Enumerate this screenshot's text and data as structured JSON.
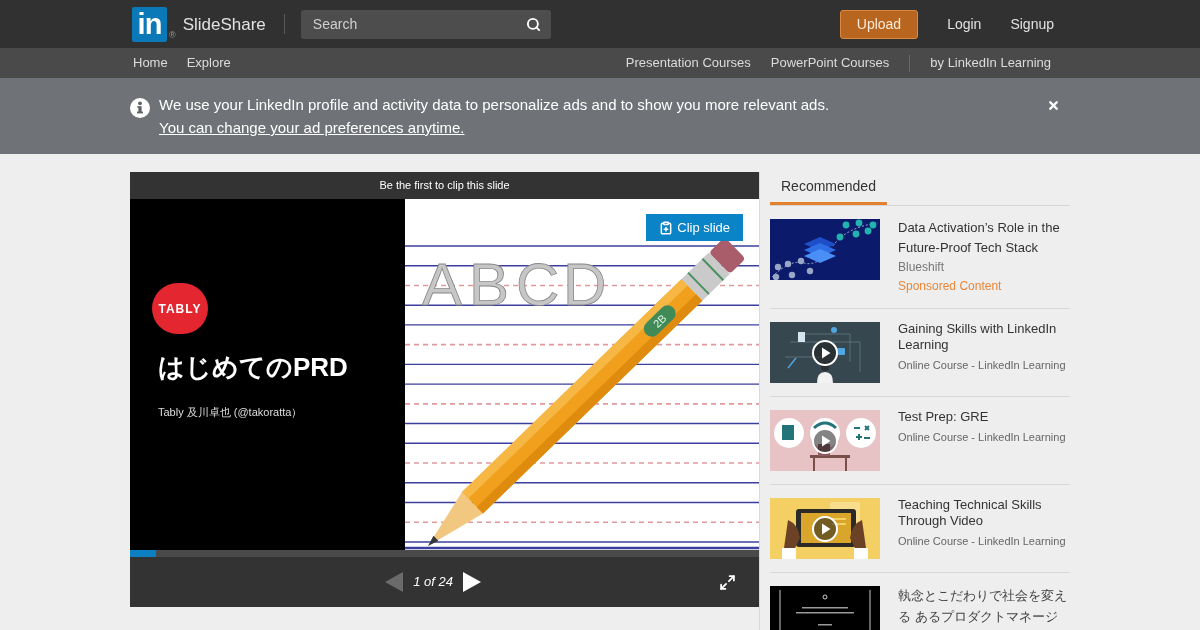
{
  "header": {
    "logo": {
      "mark": "in",
      "registered": "®",
      "name": "SlideShare"
    },
    "search": {
      "placeholder": "Search"
    },
    "buttons": [
      {
        "kind": "primary",
        "label": "Upload"
      },
      {
        "kind": "link",
        "label": "Login"
      },
      {
        "kind": "link",
        "label": "Signup"
      }
    ]
  },
  "sub_nav": {
    "left": [
      "Home",
      "Explore"
    ],
    "right": [
      "Presentation Courses",
      "PowerPoint Courses"
    ],
    "partner": "by LinkedIn Learning"
  },
  "notice": {
    "text": "We use your LinkedIn profile and activity data to personalize ads and to show you more relevant ads.",
    "link": "You can change your ad preferences anytime."
  },
  "player": {
    "clip_bar": "Be the first to clip this slide",
    "slide": {
      "logo": "TABLY",
      "title": "はじめてのPRD",
      "byline": "Tably 及川卓也 (@takoratta）",
      "paper_letters": [
        "A",
        "B",
        "C",
        "D"
      ],
      "pencil_label": "2B"
    },
    "clip_button": "Clip slide",
    "progress": {
      "level": 0.0417
    },
    "prev": {
      "disabled": true
    },
    "next": {
      "disabled": false
    },
    "page_indicator": "1 of 24"
  },
  "sidebar": {
    "tabs": [
      {
        "label": "Recommended",
        "selected": true
      }
    ],
    "items": [
      {
        "kind": "sponsored",
        "title": "Data Activation’s Role in the Future-Proof Tech Stack",
        "source": "Blueshift",
        "label": "Sponsored Content"
      },
      {
        "kind": "course",
        "title": "Gaining Skills with LinkedIn Learning",
        "source": "Online Course - LinkedIn Learning"
      },
      {
        "kind": "course",
        "title": "Test Prep: GRE",
        "source": "Online Course - LinkedIn Learning"
      },
      {
        "kind": "course",
        "title": "Teaching Technical Skills Through Video",
        "source": "Online Course - LinkedIn Learning"
      },
      {
        "kind": "slideshow",
        "title": "執念とこだわりで社会を変える あるプロダクトマネージ"
      }
    ]
  }
}
